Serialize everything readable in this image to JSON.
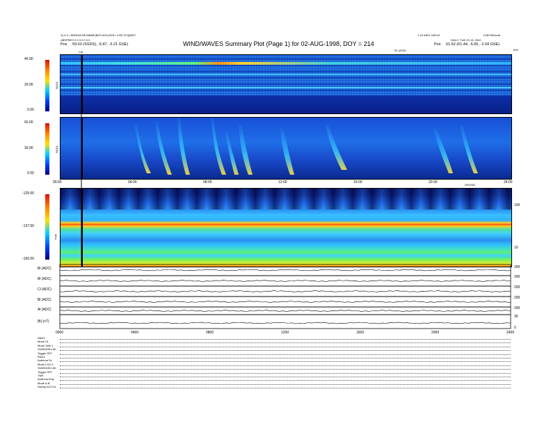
{
  "header": {
    "left_line1": "11.5.3 • 8003000 BP40BMF(BDS 600) BDS+ 4 RE DT@BPC",
    "left_line2": "ABSPRES 2.0 3 0 0 5 0",
    "left_line3_label": "Pos",
    "left_line3_value": "59.03 (SSDS), -5.47, -3.21 GSE)",
    "title": "WIND/WAVES Summary Plot (Page 1) for 02-AUG-1998, DOY = 214",
    "right_line1": "1.16 WED 34FOG",
    "right_line1b": "LEB700Dmat",
    "right_line2": "DAILY: TUE 23 15, 2002",
    "right_line3_label": "Pos",
    "right_line3_value": "61.52 (61.44, -5.65, -2.04 GSE)",
    "marker_top_left": "Cal",
    "marker_top_mid": "TE-UPGE",
    "marker_top_right": "kHz"
  },
  "chart_data": [
    {
      "type": "heatmap",
      "name_label": "RAD2",
      "colorbar_ticks": [
        "40.00",
        "20.00",
        "0.00"
      ],
      "zlim": [
        0,
        40
      ],
      "right_ticks": [],
      "note": "radio receiver 2 dynamic spectrum"
    },
    {
      "type": "heatmap",
      "name_label": "RAD1",
      "colorbar_ticks": [
        "60.00",
        "30.00",
        "0.00"
      ],
      "zlim": [
        0,
        60
      ],
      "right_ticks": [],
      "x_ticks": [
        "00:00",
        "04:00",
        "08:00",
        "12:00",
        "16:00",
        "20:00",
        "24:00"
      ]
    },
    {
      "type": "heatmap",
      "name_label": "TNR",
      "colorbar_ticks": [
        "-125.00",
        "-137.50",
        "-150.00"
      ],
      "zlim": [
        -150,
        -125
      ],
      "right_ticks": [
        "100",
        "10"
      ],
      "top_right_label": "DRV/DE"
    },
    {
      "type": "line",
      "rows": [
        {
          "label": "Bl (ADC)",
          "ticks": [
            "200",
            "0",
            "-200"
          ]
        },
        {
          "label": "Bl (ADC)",
          "ticks": [
            "200",
            "0",
            "-200"
          ]
        },
        {
          "label": "Cl (ADC)",
          "ticks": [
            "200",
            "0",
            "-200"
          ]
        },
        {
          "label": "Bl (ADC)",
          "ticks": [
            "200",
            "0",
            "-200"
          ]
        },
        {
          "label": "Al (ADC)",
          "ticks": [
            "200",
            "0",
            "-200"
          ]
        },
        {
          "label": "|B| (nT)",
          "ticks": [
            "30",
            "20",
            "10",
            "0"
          ]
        }
      ],
      "x_ticks": [
        "0000",
        "0400",
        "0800",
        "1200",
        "1600",
        "2000",
        "2400"
      ]
    }
  ],
  "modes": [
    "RAD2",
    "Mode    SL",
    "Mode    1Mb 1",
    "SUMGAIN Ldb",
    "Toggle  OFF",
    "RAD1",
    "Antenna  Sx",
    "Mode    LOG 2",
    "SUMGAIN Ldb",
    "Toggle  OFF",
    "TNR",
    "Antenna  Exfy",
    "Mode     A-B",
    "Sweep  ACCOL"
  ]
}
